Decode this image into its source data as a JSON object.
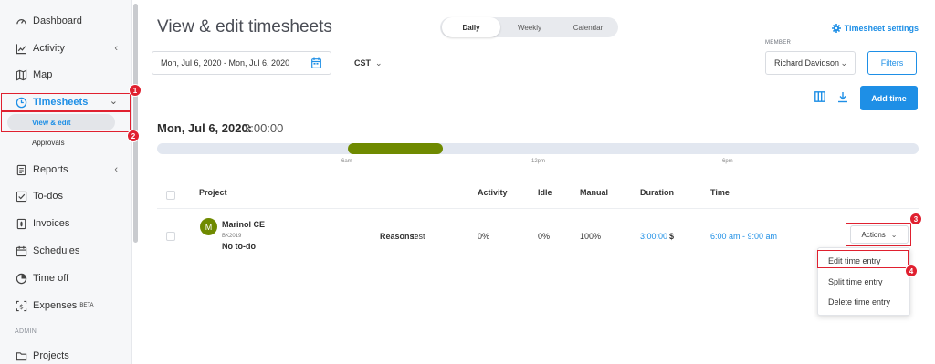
{
  "sidebar": {
    "items": [
      {
        "label": "Dashboard",
        "icon": "gauge-icon"
      },
      {
        "label": "Activity",
        "icon": "chart-line-icon",
        "chevron": "‹"
      },
      {
        "label": "Map",
        "icon": "map-icon"
      },
      {
        "label": "Timesheets",
        "icon": "clock-icon",
        "chevron": "⌄"
      },
      {
        "label": "Reports",
        "icon": "report-icon",
        "chevron": "‹"
      },
      {
        "label": "To-dos",
        "icon": "checkbox-icon"
      },
      {
        "label": "Invoices",
        "icon": "invoice-icon"
      },
      {
        "label": "Schedules",
        "icon": "calendar-icon"
      },
      {
        "label": "Time off",
        "icon": "pie-icon"
      },
      {
        "label": "Expenses",
        "beta": "BETA",
        "icon": "expenses-icon"
      },
      {
        "label": "Projects",
        "icon": "folder-icon"
      }
    ],
    "sub_items": [
      "View & edit",
      "Approvals"
    ],
    "section_label": "ADMIN"
  },
  "header": {
    "title": "View & edit timesheets",
    "views": [
      "Daily",
      "Weekly",
      "Calendar"
    ],
    "selected_view": "Daily",
    "settings_link": "Timesheet settings"
  },
  "filters": {
    "date_range": "Mon, Jul 6, 2020 - Mon, Jul 6, 2020",
    "timezone": "CST",
    "member_label": "MEMBER",
    "member": "Richard Davidson",
    "filters_button": "Filters",
    "add_time_button": "Add time"
  },
  "day": {
    "heading": "Mon, Jul 6, 2020:",
    "duration": "3:00:00",
    "timeline_ticks": [
      "6am",
      "12pm",
      "6pm"
    ],
    "entry_start_hour": 6,
    "entry_end_hour": 9
  },
  "table": {
    "headers": [
      "Project",
      "Activity",
      "Idle",
      "Manual",
      "Duration",
      "Time"
    ],
    "rows": [
      {
        "avatar": "M",
        "project": "Marinol CE",
        "code": "BK2019",
        "todo": "No to-do",
        "reasons_label": "Reasons:",
        "reasons": "test",
        "activity": "0%",
        "idle": "0%",
        "manual": "100%",
        "duration": "3:00:00",
        "currency": "$",
        "time": "6:00 am - 9:00 am",
        "actions": "Actions"
      }
    ]
  },
  "actions_menu": [
    "Edit time entry",
    "Split time entry",
    "Delete time entry"
  ],
  "annotations": [
    "1",
    "2",
    "3",
    "4"
  ],
  "colors": {
    "accent": "#1e8fe6",
    "entry_bar": "#6f8a00",
    "highlight": "#e0202f"
  }
}
